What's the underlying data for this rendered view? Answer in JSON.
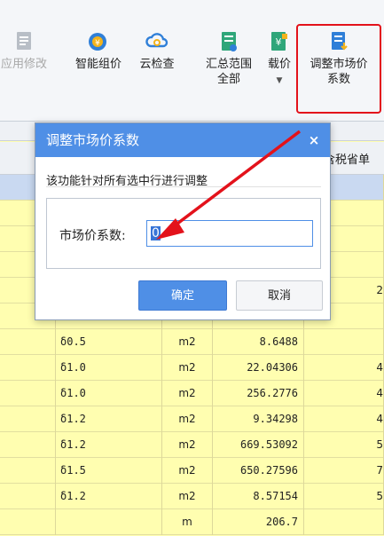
{
  "ribbon": {
    "buttons": [
      {
        "label": "应用修改",
        "icon": "document-edit-icon",
        "disabled": true
      },
      {
        "label": "智能组价",
        "icon": "smart-pricing-icon"
      },
      {
        "label": "云检查",
        "icon": "cloud-check-icon"
      },
      {
        "label": "汇总范围\n全部",
        "icon": "summary-range-icon"
      },
      {
        "label": "载价",
        "icon": "load-price-icon",
        "has_dropdown": true
      },
      {
        "label": "调整市场价\n系数",
        "icon": "adjust-market-price-icon"
      }
    ]
  },
  "grid": {
    "header_partial": "含税省单",
    "rows": [
      {
        "spec": "",
        "unit": "",
        "amount": "",
        "extra": ""
      },
      {
        "spec": "",
        "unit": "",
        "amount": "",
        "extra": ""
      },
      {
        "spec": "",
        "unit": "",
        "amount": "",
        "extra": ""
      },
      {
        "spec": "",
        "unit": "",
        "amount": "",
        "extra": ""
      },
      {
        "spec": "",
        "unit": "",
        "amount": "",
        "extra": "2"
      },
      {
        "spec": "",
        "unit": "",
        "amount": "",
        "extra": ""
      },
      {
        "spec": "δ0.5",
        "unit": "m2",
        "amount": "8.6488",
        "extra": ""
      },
      {
        "spec": "δ1.0",
        "unit": "m2",
        "amount": "22.04306",
        "extra": "4"
      },
      {
        "spec": "δ1.0",
        "unit": "m2",
        "amount": "256.2776",
        "extra": "4"
      },
      {
        "spec": "δ1.2",
        "unit": "m2",
        "amount": "9.34298",
        "extra": "4"
      },
      {
        "spec": "δ1.2",
        "unit": "m2",
        "amount": "669.53092",
        "extra": "5"
      },
      {
        "spec": "δ1.5",
        "unit": "m2",
        "amount": "650.27596",
        "extra": "7"
      },
      {
        "spec": "δ1.2",
        "unit": "m2",
        "amount": "8.57154",
        "extra": "5"
      },
      {
        "spec": "",
        "unit": "m",
        "amount": "206.7",
        "extra": ""
      }
    ]
  },
  "dialog": {
    "title": "调整市场价系数",
    "close_glyph": "×",
    "description": "该功能针对所有选中行进行调整",
    "field_label": "市场价系数:",
    "field_value": "0",
    "ok_label": "确定",
    "cancel_label": "取消"
  },
  "colors": {
    "accent": "#4f8fe6",
    "highlight_red": "#e3121b",
    "row_yellow": "#fffeb0",
    "row_selected": "#c9d9f1"
  }
}
